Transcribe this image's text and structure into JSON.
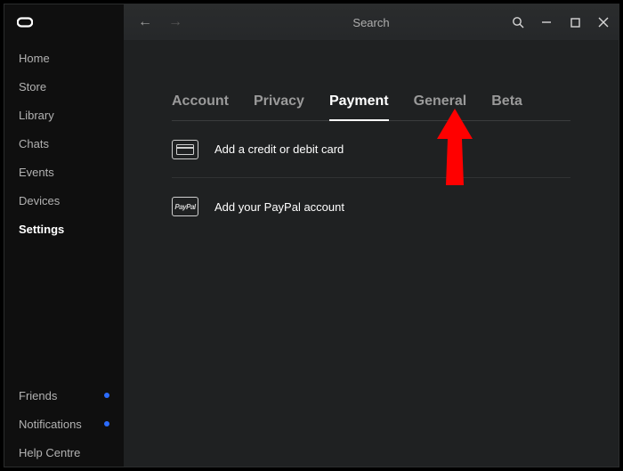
{
  "sidebar": {
    "items": [
      {
        "label": "Home"
      },
      {
        "label": "Store"
      },
      {
        "label": "Library"
      },
      {
        "label": "Chats"
      },
      {
        "label": "Events"
      },
      {
        "label": "Devices"
      },
      {
        "label": "Settings"
      }
    ],
    "bottom": [
      {
        "label": "Friends",
        "dot": true
      },
      {
        "label": "Notifications",
        "dot": true
      },
      {
        "label": "Help Centre",
        "dot": false
      }
    ]
  },
  "topbar": {
    "search_placeholder": "Search"
  },
  "tabs": [
    {
      "label": "Account"
    },
    {
      "label": "Privacy"
    },
    {
      "label": "Payment"
    },
    {
      "label": "General"
    },
    {
      "label": "Beta"
    }
  ],
  "options": {
    "card": {
      "label": "Add a credit or debit card"
    },
    "paypal": {
      "label": "Add your PayPal account",
      "icon_text": "PayPal"
    }
  }
}
